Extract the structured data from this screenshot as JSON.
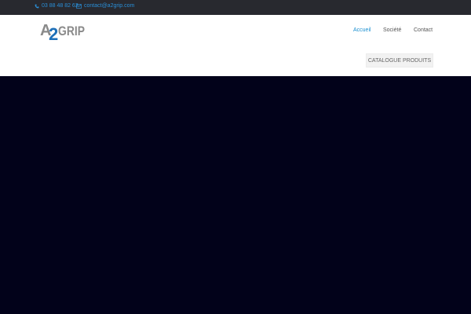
{
  "topbar": {
    "phone": "03 88 48 82 62",
    "email": "contact@a2grip.com"
  },
  "logo": {
    "text_a": "A",
    "text_2": "2",
    "text_grip": "GRIP",
    "colors": {
      "gray": "#8a8a8a",
      "blue": "#1d6fb8"
    }
  },
  "nav": {
    "items": [
      {
        "label": "Accueil",
        "active": true
      },
      {
        "label": "Société",
        "active": false
      },
      {
        "label": "Contact",
        "active": false
      }
    ]
  },
  "catalogue_button": {
    "label": "CATALOGUE PRODUITS"
  },
  "colors": {
    "topbar_bg": "#28292f",
    "link_blue": "#2a8fd8",
    "active_nav": "#1a8fd0",
    "hero_bg": "#02021a"
  }
}
